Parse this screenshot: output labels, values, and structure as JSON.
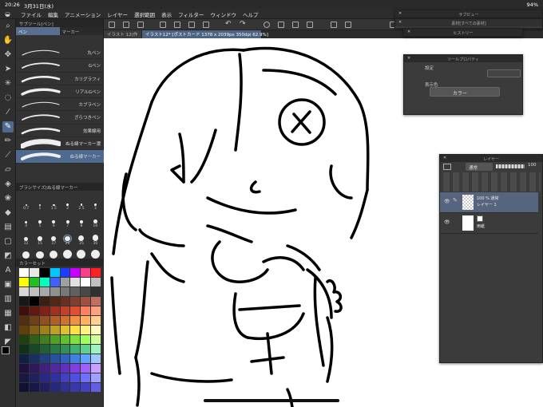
{
  "status": {
    "time": "20:26",
    "date": "3月31日(水)",
    "battery": "94%"
  },
  "menu": [
    "ファイル",
    "編集",
    "アニメーション",
    "レイヤー",
    "選択範囲",
    "表示",
    "フィルター",
    "ウィンドウ",
    "ヘルプ"
  ],
  "sub_tool_panel": {
    "title": "サブツール[ペン]",
    "tabs": [
      "ペン",
      "マーカー"
    ],
    "brushes": [
      "丸ペン",
      "Gペン",
      "カリグラフィ",
      "リアルGペン",
      "カブラペン",
      "ざらつきペン",
      "効果線用",
      "ぬる線マーカー濃",
      "ぬる線マーカー"
    ]
  },
  "brush_size_panel": {
    "title": "ブラシサイズ[ぬる線マーカー",
    "sizes": [
      "0.7",
      "1",
      "1.5",
      "2",
      "2.5",
      "3",
      "4",
      "5",
      "6",
      "7",
      "8",
      "10",
      "12",
      "15",
      "17",
      "20",
      "25",
      "30",
      "40",
      "50",
      "60",
      "70",
      "80",
      "100"
    ]
  },
  "color_set": {
    "title": "カラーセット"
  },
  "file_tabs": [
    "イラスト 12(作",
    "イラスト12* [ポストカード 1378 x 2039px 350dpi 62.9%]"
  ],
  "navigator_panels": {
    "subview": "サブビュー",
    "history": "ヒストリー",
    "subview_hint": "素材[すべての素材]"
  },
  "tool_property": {
    "title": "ツールプロパティ",
    "display_color_label": "表示色",
    "color_value": "カラー",
    "setting_label": "設定"
  },
  "layer_panel": {
    "title": "レイヤー",
    "blend_mode": "通常",
    "opacity": "100",
    "layers": [
      {
        "opacity": "100 % 通常",
        "name": "レイヤー 1"
      },
      {
        "opacity": "",
        "name": "用紙"
      }
    ]
  },
  "colors": {
    "accent": "#4f6a8f",
    "panel": "#333333",
    "canvas": "#ffffff"
  }
}
